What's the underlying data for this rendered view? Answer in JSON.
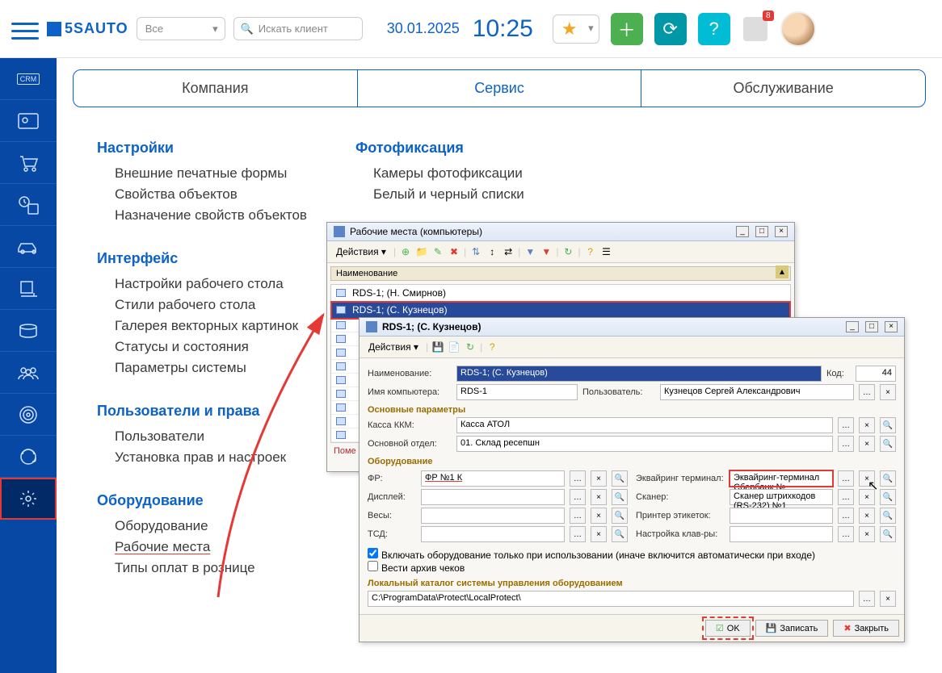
{
  "topbar": {
    "logo": "5SAUTO",
    "select_all": "Все",
    "search_placeholder": "Искать клиент",
    "date": "30.01.2025",
    "time": "10:25",
    "badge": "8"
  },
  "tabs": {
    "company": "Компания",
    "service": "Сервис",
    "maintenance": "Обслуживание"
  },
  "settings": {
    "h_settings": "Настройки",
    "ext_forms": "Внешние печатные формы",
    "obj_props": "Свойства объектов",
    "prop_assign": "Назначение свойств объектов",
    "h_photo": "Фотофиксация",
    "cameras": "Камеры фотофиксации",
    "lists": "Белый и черный списки",
    "h_interface": "Интерфейс",
    "desk_settings": "Настройки рабочего стола",
    "desk_styles": "Стили рабочего стола",
    "gallery": "Галерея векторных картинок",
    "statuses": "Статусы и состояния",
    "sys_params": "Параметры системы",
    "h_users": "Пользователи и права",
    "users": "Пользователи",
    "rights": "Установка прав и настроек",
    "h_equip": "Оборудование",
    "equipment": "Оборудование",
    "workplaces": "Рабочие места",
    "pay_types": "Типы оплат в рознице"
  },
  "win1": {
    "title": "Рабочие места (компьютеры)",
    "actions": "Действия",
    "col_name": "Наименование",
    "rows": [
      "RDS-1; (Н. Смирнов)",
      "RDS-1; (С. Кузнецов)"
    ],
    "footer": "Поме"
  },
  "win2": {
    "title": "RDS-1; (С. Кузнецов)",
    "actions": "Действия",
    "lbl_name": "Наименование:",
    "val_name": "RDS-1; (С. Кузнецов)",
    "lbl_code": "Код:",
    "val_code": "44",
    "lbl_comp": "Имя компьютера:",
    "val_comp": "RDS-1",
    "lbl_user": "Пользователь:",
    "val_user": "Кузнецов Сергей Александрович",
    "sec_main": "Основные параметры",
    "lbl_kkm": "Касса ККМ:",
    "val_kkm": "Касса АТОЛ",
    "lbl_dept": "Основной отдел:",
    "val_dept": "01. Склад ресепшн",
    "sec_equip": "Оборудование",
    "lbl_fr": "ФР:",
    "val_fr": "ФР №1 К",
    "lbl_acq": "Эквайринг терминал:",
    "val_acq": "Эквайринг-терминал Сбербанк №",
    "lbl_disp": "Дисплей:",
    "lbl_scan": "Сканер:",
    "val_scan": "Сканер штрихкодов (RS-232) №1",
    "lbl_scale": "Весы:",
    "lbl_print": "Принтер этикеток:",
    "lbl_tsd": "ТСД:",
    "lbl_keyb": "Настройка клав-ры:",
    "chk_enable": "Включать оборудование только при использовании (иначе включится автоматически при входе)",
    "chk_archive": "Вести архив чеков",
    "sec_local": "Локальный каталог системы управления оборудованием",
    "val_path": "C:\\ProgramData\\Protect\\LocalProtect\\",
    "btn_ok": "OK",
    "btn_save": "Записать",
    "btn_close": "Закрыть"
  }
}
